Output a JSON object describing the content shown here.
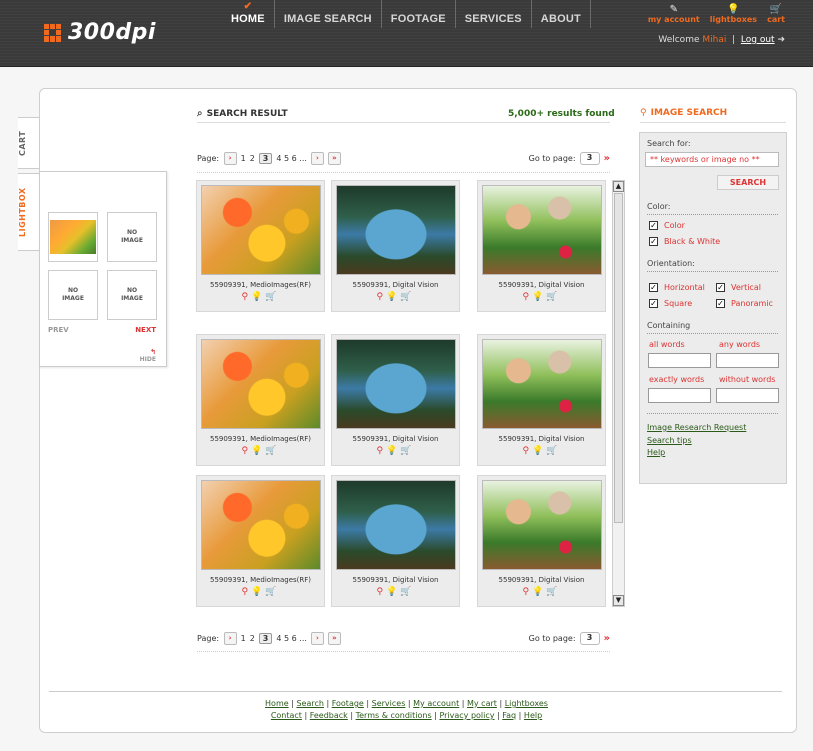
{
  "header": {
    "logo_text": "300dpi",
    "nav": [
      "HOME",
      "IMAGE SEARCH",
      "FOOTAGE",
      "SERVICES",
      "ABOUT"
    ],
    "active_nav": "HOME",
    "top_links": [
      "my account",
      "lightboxes",
      "cart"
    ],
    "welcome_prefix": "Welcome",
    "user_name": "Mihai",
    "separator": "|",
    "logout": "Log out"
  },
  "side_tabs": {
    "cart": "CART",
    "lightbox": "LIGHTBOX"
  },
  "lightbox": {
    "no_image": "NO\nIMAGE",
    "prev": "PREV",
    "next": "NEXT",
    "hide": "HIDE"
  },
  "results": {
    "title": "SEARCH RESULT",
    "found": "5,000+ results found",
    "pager": {
      "page_label": "Page:",
      "pages_before": [
        "1",
        "2"
      ],
      "current": "3",
      "pages_after": "4 5 6 ...",
      "goto_label": "Go to page:",
      "goto_value": "3"
    },
    "rows": [
      [
        {
          "caption": "55909391, MedioImages(RF)",
          "image": "flowers"
        },
        {
          "caption": "55909391, Digital Vision",
          "image": "van"
        },
        {
          "caption": "55909391, Digital Vision",
          "image": "garden"
        }
      ],
      [
        {
          "caption": "55909391, MedioImages(RF)",
          "image": "flowers"
        },
        {
          "caption": "55909391, Digital Vision",
          "image": "van"
        },
        {
          "caption": "55909391, Digital Vision",
          "image": "garden"
        }
      ],
      [
        {
          "caption": "55909391, MedioImages(RF)",
          "image": "flowers"
        },
        {
          "caption": "55909391, Digital Vision",
          "image": "van"
        },
        {
          "caption": "55909391, Digital Vision",
          "image": "garden"
        }
      ]
    ]
  },
  "search_panel": {
    "title": "IMAGE SEARCH",
    "search_for_label": "Search for:",
    "search_placeholder": "** keywords or image no **",
    "search_button": "SEARCH",
    "color_label": "Color:",
    "color_options": [
      "Color",
      "Black & White"
    ],
    "orientation_label": "Orientation:",
    "orientation_options": [
      "Horizontal",
      "Vertical",
      "Square",
      "Panoramic"
    ],
    "containing_label": "Containing",
    "containing_fields": [
      "all words",
      "any words",
      "exactly words",
      "without words"
    ],
    "links": [
      "Image Research Request",
      "Search tips",
      "Help"
    ]
  },
  "footer": {
    "line1": [
      "Home",
      "Search",
      "Footage",
      "Services",
      "My account",
      "My cart",
      "Lightboxes"
    ],
    "line2": [
      "Contact",
      "Feedback",
      "Terms & conditions",
      "Privacy policy",
      "Faq",
      "Help"
    ]
  },
  "colors": {
    "accent": "#f06a1e",
    "link": "#2b5a1a",
    "header_bg": "#3a3a3a"
  }
}
